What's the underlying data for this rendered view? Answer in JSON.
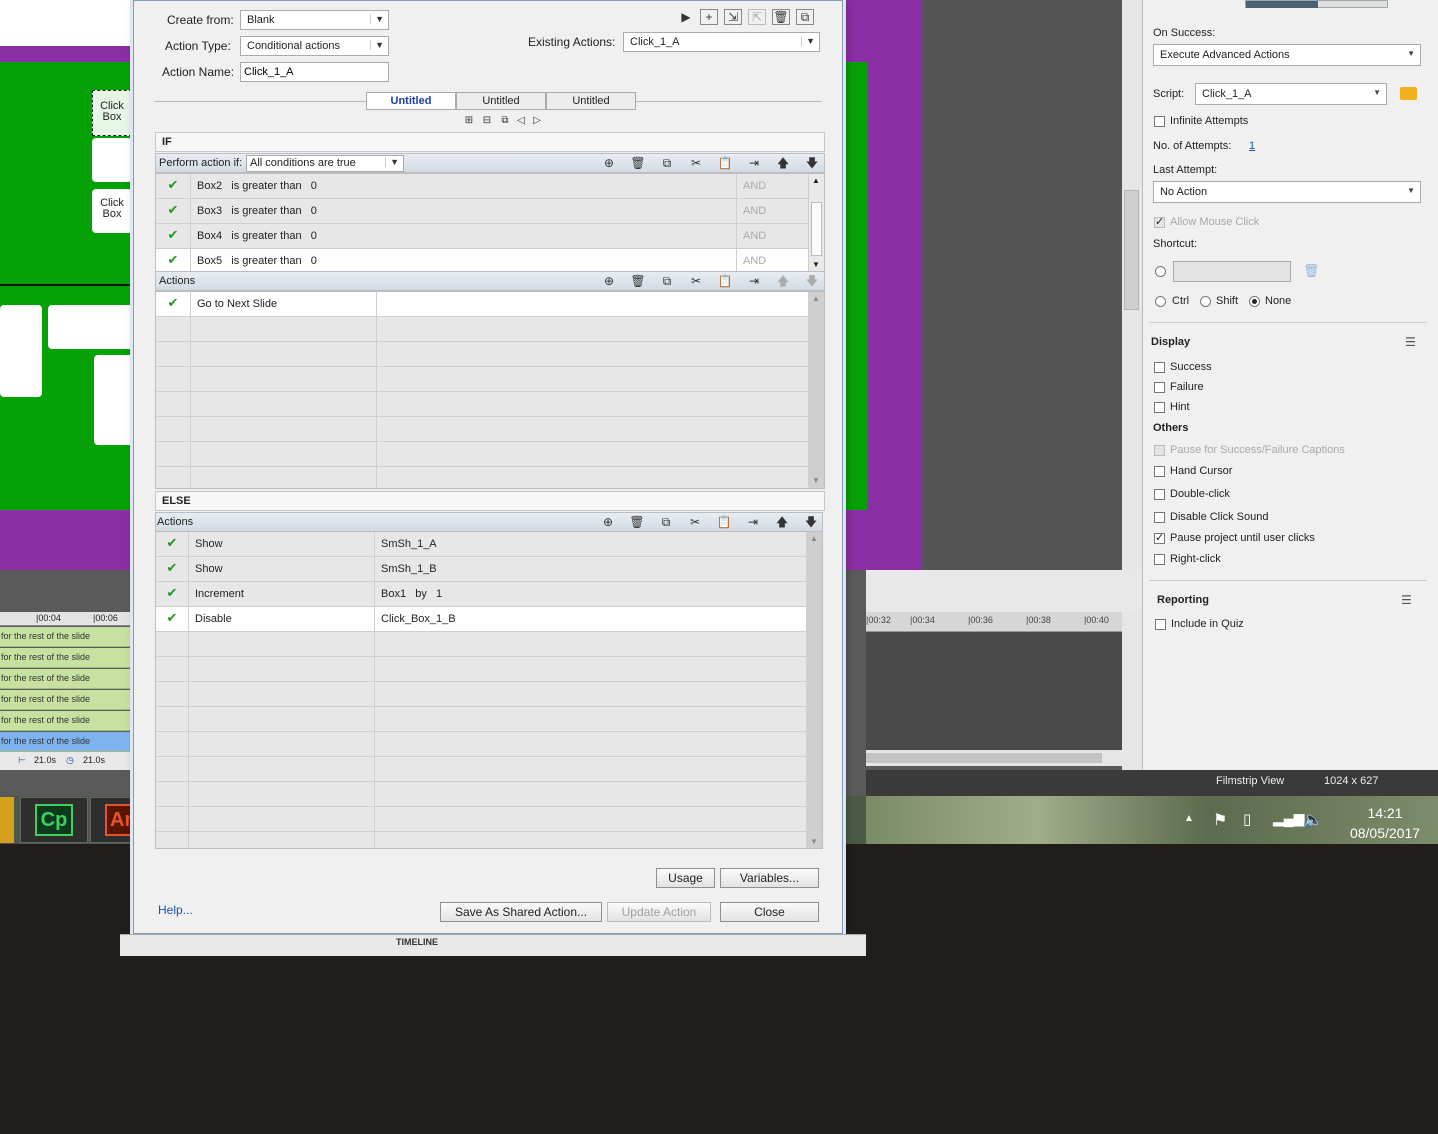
{
  "dialog": {
    "create_from_label": "Create from:",
    "create_from_value": "Blank",
    "action_type_label": "Action Type:",
    "action_type_value": "Conditional actions",
    "action_name_label": "Action Name:",
    "action_name_value": "Click_1_A",
    "existing_actions_label": "Existing Actions:",
    "existing_actions_value": "Click_1_A",
    "tabs": [
      {
        "label": "Untitled",
        "active": true
      },
      {
        "label": "Untitled",
        "active": false
      },
      {
        "label": "Untitled",
        "active": false
      }
    ],
    "if_label": "IF",
    "perform_label": "Perform action if:",
    "perform_value": "All conditions are true",
    "conditions": [
      {
        "var": "Box2",
        "op": "is greater than",
        "val": "0",
        "join": "AND"
      },
      {
        "var": "Box3",
        "op": "is greater than",
        "val": "0",
        "join": "AND"
      },
      {
        "var": "Box4",
        "op": "is greater than",
        "val": "0",
        "join": "AND"
      },
      {
        "var": "Box5",
        "op": "is greater than",
        "val": "0",
        "join": "AND"
      }
    ],
    "if_actions_label": "Actions",
    "if_actions": [
      {
        "action": "Go to Next Slide",
        "target": ""
      }
    ],
    "else_label": "ELSE",
    "else_actions_label": "Actions",
    "else_actions": [
      {
        "action": "Show",
        "target": "SmSh_1_A"
      },
      {
        "action": "Show",
        "target": "SmSh_1_B"
      },
      {
        "action": "Increment",
        "target": "Box1   by   1"
      },
      {
        "action": "Disable",
        "target": "Click_Box_1_B"
      }
    ],
    "usage_label": "Usage",
    "variables_label": "Variables...",
    "help_label": "Help...",
    "save_shared_label": "Save As Shared Action...",
    "update_label": "Update Action",
    "close_label": "Close"
  },
  "props": {
    "on_success_label": "On Success:",
    "on_success_value": "Execute Advanced Actions",
    "script_label": "Script:",
    "script_value": "Click_1_A",
    "infinite_label": "Infinite Attempts",
    "attempts_label": "No. of Attempts:",
    "attempts_value": "1",
    "last_attempt_label": "Last Attempt:",
    "last_attempt_value": "No Action",
    "allow_mouse_label": "Allow Mouse Click",
    "shortcut_label": "Shortcut:",
    "mod_ctrl": "Ctrl",
    "mod_shift": "Shift",
    "mod_none": "None",
    "display_title": "Display",
    "display_items": [
      "Success",
      "Failure",
      "Hint"
    ],
    "others_title": "Others",
    "others_items": [
      {
        "label": "Pause for Success/Failure Captions",
        "checked": false,
        "disabled": true
      },
      {
        "label": "Hand Cursor",
        "checked": false,
        "disabled": false
      },
      {
        "label": "Double-click",
        "checked": false,
        "disabled": false
      },
      {
        "label": "Disable Click Sound",
        "checked": false,
        "disabled": false
      },
      {
        "label": "Pause project until user clicks",
        "checked": true,
        "disabled": false
      },
      {
        "label": "Right-click",
        "checked": false,
        "disabled": false
      }
    ],
    "reporting_title": "Reporting",
    "include_quiz_label": "Include in Quiz"
  },
  "stage": {
    "click_box_label_1": "Click Box",
    "click_box_label_2": "Click Box"
  },
  "timeline": {
    "title": "TIMELINE",
    "ruler_left": [
      "|00:04",
      "|00:06"
    ],
    "ruler_right": [
      "|00:32",
      "|00:34",
      "|00:36",
      "|00:38",
      "|00:40"
    ],
    "row_text": "for the rest of the slide",
    "duration_1": "21.0s",
    "duration_2": "21.0s"
  },
  "status": {
    "filmstrip": "Filmstrip View",
    "resolution": "1024 x 627"
  },
  "taskbar": {
    "cp_label": "Cp",
    "an_label": "An",
    "time": "14:21",
    "date": "08/05/2017"
  },
  "colors": {
    "stage_green": "#06a106",
    "stage_purple": "#8a2ea5",
    "check_green": "#1d9a1d",
    "tab_active_text": "#1b3da8"
  }
}
